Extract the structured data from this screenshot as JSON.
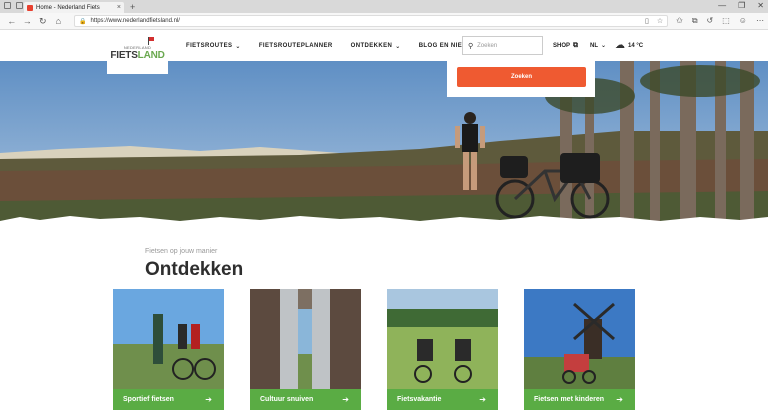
{
  "browser": {
    "tab_title": "Home - Nederland Fiets",
    "tab_close": "×",
    "new_tab": "+",
    "url": "https://www.nederlandfietsland.nl/",
    "window_controls": [
      "—",
      "❐",
      "✕"
    ]
  },
  "header": {
    "logo_small": "NEDERLAND",
    "logo_fiets": "FIETS",
    "logo_land": "LAND",
    "nav": [
      {
        "label": "FIETSROUTES",
        "chevron": "⌄"
      },
      {
        "label": "FIETSROUTEPLANNER",
        "chevron": ""
      },
      {
        "label": "ONTDEKKEN",
        "chevron": "⌄"
      },
      {
        "label": "BLOG EN NIEUWS",
        "chevron": ""
      }
    ],
    "search_placeholder": "Zoeken",
    "shop_label": "SHOP",
    "lang_label": "NL",
    "weather_label": "14 °C"
  },
  "search_dropdown": {
    "button_label": "Zoeken",
    "button_color": "#ef5a31"
  },
  "content": {
    "subtitle": "Fietsen op jouw manier",
    "heading": "Ontdekken",
    "cards": [
      {
        "label": "Sportief fietsen",
        "arrow": "➔"
      },
      {
        "label": "Cultuur snuiven",
        "arrow": "➔"
      },
      {
        "label": "Fietsvakantie",
        "arrow": "➔"
      },
      {
        "label": "Fietsen met kinderen",
        "arrow": "➔"
      }
    ],
    "card_color": "#5aac44"
  }
}
